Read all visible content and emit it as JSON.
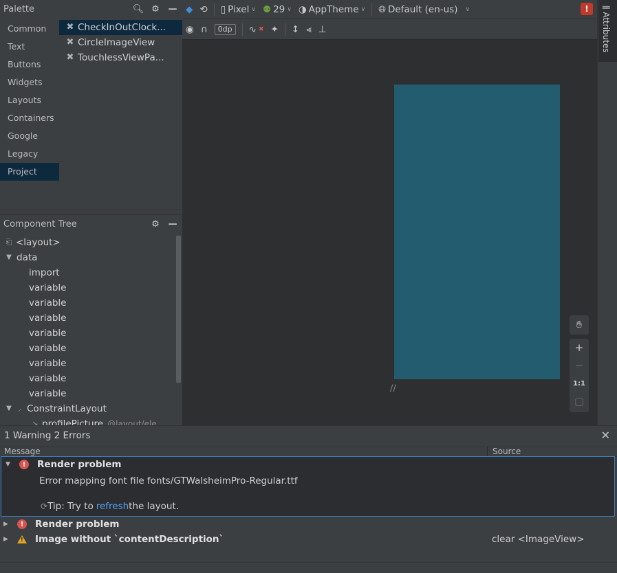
{
  "palette": {
    "title": "Palette",
    "categories": [
      "Common",
      "Text",
      "Buttons",
      "Widgets",
      "Layouts",
      "Containers",
      "Google",
      "Legacy",
      "Project"
    ],
    "selected_category": "Project",
    "items": [
      "CheckInOutClock...",
      "CircleImageView",
      "TouchlessViewPa..."
    ]
  },
  "component_tree": {
    "title": "Component Tree",
    "rows": [
      {
        "label": "<layout>"
      },
      {
        "label": "data"
      },
      {
        "label": "import"
      },
      {
        "label": "variable"
      },
      {
        "label": "variable"
      },
      {
        "label": "variable"
      },
      {
        "label": "variable"
      },
      {
        "label": "variable"
      },
      {
        "label": "variable"
      },
      {
        "label": "variable"
      },
      {
        "label": "variable"
      },
      {
        "label": "ConstraintLayout"
      },
      {
        "label": "profilePicture",
        "hint": "@layout/ele..."
      }
    ]
  },
  "toolbar": {
    "device": "Pixel",
    "api": "29",
    "theme": "AppTheme",
    "locale": "Default (en-us)",
    "margin": "0dp"
  },
  "zoom": {
    "plus": "+",
    "minus": "−",
    "one_to_one": "1:1"
  },
  "attributes_tab": "Attributes",
  "problems": {
    "title": "1 Warning 2 Errors",
    "col_message": "Message",
    "col_source": "Source",
    "rows": [
      {
        "title": "Render problem",
        "detail": "Error mapping font file fonts/GTWalsheimPro-Regular.ttf",
        "tip_prefix": "Tip: Try to ",
        "tip_link": "refresh",
        "tip_suffix": " the layout."
      },
      {
        "title": "Render problem"
      },
      {
        "title": "Image without `contentDescription`",
        "source": "clear <ImageView>"
      }
    ]
  },
  "colors": {
    "panel": "#3c3f41",
    "canvas": "#2d2f30",
    "device": "#235c6e",
    "selection": "#0d293e",
    "error": "#d9534f",
    "warning": "#e0a526",
    "link": "#589df6"
  }
}
